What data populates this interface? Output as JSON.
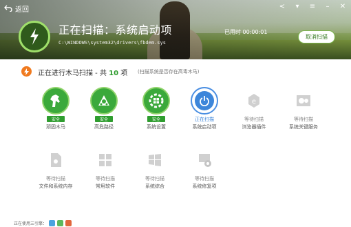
{
  "header": {
    "back_label": "返回",
    "title": "正在扫描：系统启动项",
    "path": "C:\\WINDOWS\\system32\\drivers\\fbdem.sys",
    "elapsed": "已用时 00:00:01",
    "cancel_label": "取消扫描"
  },
  "status": {
    "prefix": "正在进行木马扫描 - 共",
    "count": "10",
    "suffix": "项",
    "hint": "(扫描系统是否存在高毒木马)"
  },
  "items": [
    {
      "label": "顽固木马",
      "status": "安全",
      "state": "safe",
      "icon": "horse-icon"
    },
    {
      "label": "高危路径",
      "status": "安全",
      "state": "safe",
      "icon": "network-icon"
    },
    {
      "label": "系统设置",
      "status": "安全",
      "state": "safe",
      "icon": "windows-gear-icon"
    },
    {
      "label": "系统启动项",
      "status": "正在扫描",
      "state": "scanning",
      "icon": "power-icon"
    },
    {
      "label": "浏览器插件",
      "status": "等待扫描",
      "state": "waiting",
      "icon": "ie-icon"
    },
    {
      "label": "系统关键服务",
      "status": "等待扫描",
      "state": "waiting",
      "icon": "service-gear-icon"
    },
    {
      "label": "文件和系统内存",
      "status": "等待扫描",
      "state": "waiting",
      "icon": "file-icon"
    },
    {
      "label": "常用软件",
      "status": "等待扫描",
      "state": "waiting",
      "icon": "apps-icon"
    },
    {
      "label": "系统综合",
      "status": "等待扫描",
      "state": "waiting",
      "icon": "windows-icon"
    },
    {
      "label": "系统修复项",
      "status": "等待扫描",
      "state": "waiting",
      "icon": "repair-icon"
    }
  ],
  "footer": {
    "label": "正在使用三引擎："
  },
  "colors": {
    "safe": "#3ba93b",
    "scanning": "#3d86da",
    "waiting": "#c8c8c8",
    "status_icon": "#f07a1f"
  }
}
